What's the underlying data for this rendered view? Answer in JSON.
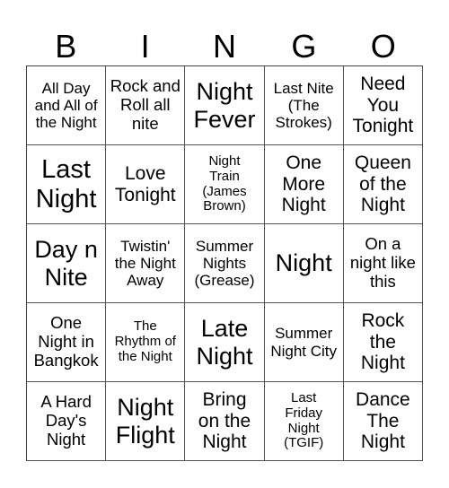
{
  "header": {
    "letters": [
      "B",
      "I",
      "N",
      "G",
      "O"
    ]
  },
  "card": {
    "rows": [
      [
        "All Day and All of the Night",
        "Rock and Roll all nite",
        "Night Fever",
        "Last Nite (The Strokes)",
        "Need You Tonight"
      ],
      [
        "Last Night",
        "Love Tonight",
        "Night Train (James Brown)",
        "One More Night",
        "Queen of the Night"
      ],
      [
        "Day n Nite",
        "Twistin' the Night Away",
        "Summer Nights (Grease)",
        "Night",
        "On a night like this"
      ],
      [
        "One Night in Bangkok",
        "The Rhythm of the Night",
        "Late Night",
        "Summer Night City",
        "Rock the Night"
      ],
      [
        "A Hard Day's Night",
        "Night Flight",
        "Bring on the Night",
        "Last Friday Night (TGIF)",
        "Dance The Night"
      ]
    ]
  },
  "colors": {
    "text": "#000000",
    "background": "#ffffff",
    "grid_line": "#555555"
  }
}
